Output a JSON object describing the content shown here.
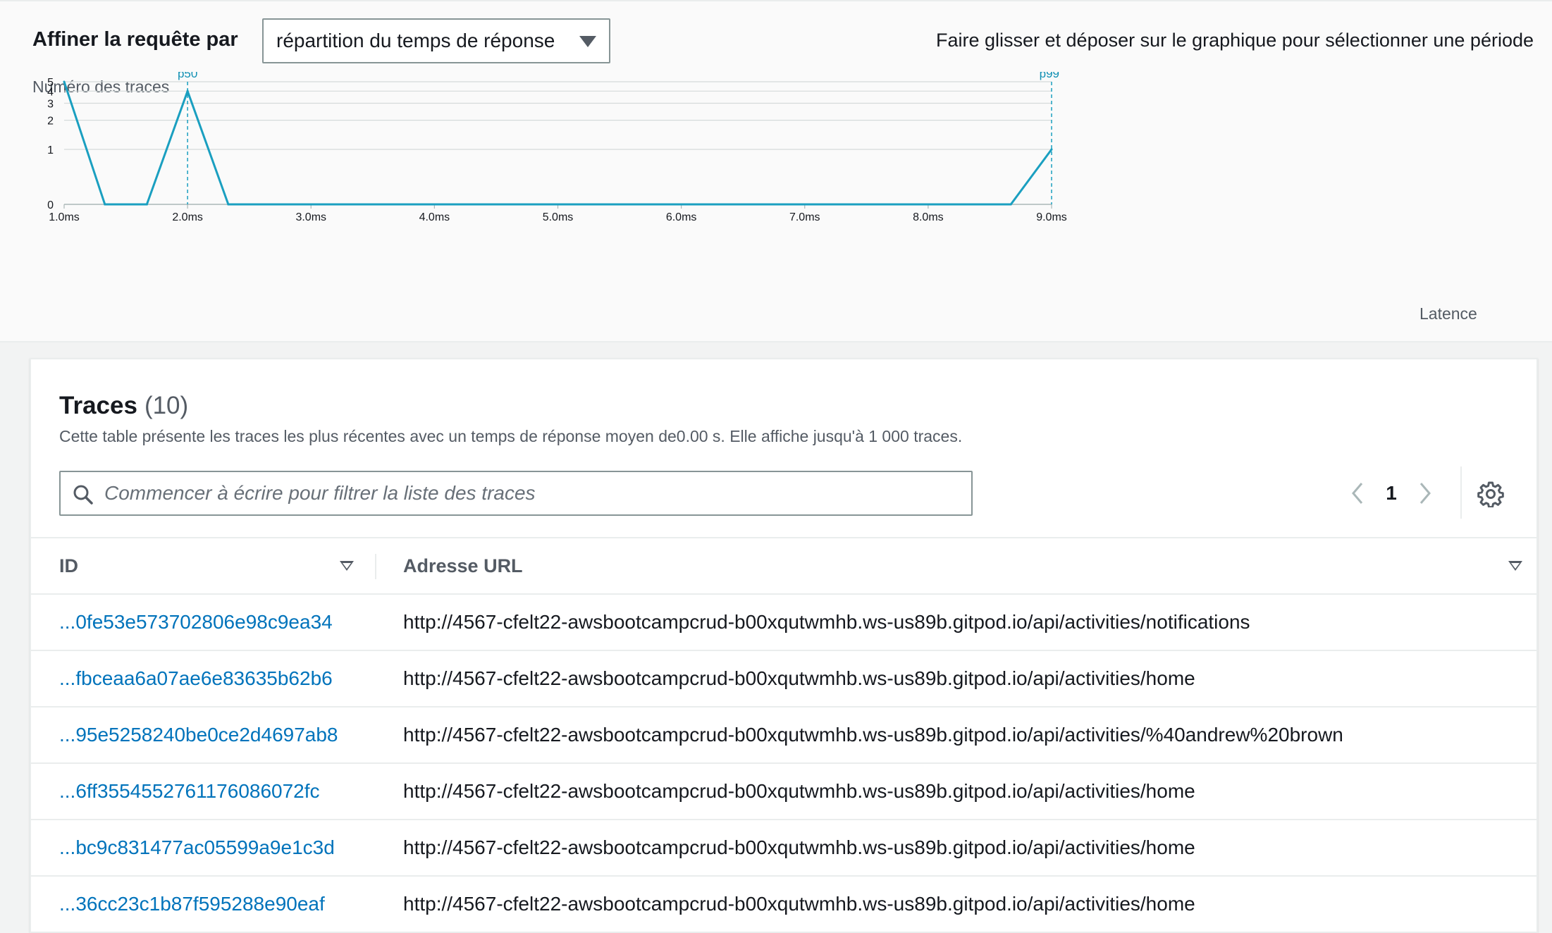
{
  "refine": {
    "label": "Affiner la requête par",
    "select_value": "répartition du temps de réponse",
    "drag_hint": "Faire glisser et déposer sur le graphique pour sélectionner une période"
  },
  "chart_data": {
    "type": "line",
    "ylabel": "Numéro des traces",
    "xlabel": "Latence",
    "x": [
      1.0,
      1.33,
      1.67,
      2.0,
      2.33,
      8.67,
      9.0
    ],
    "series": [
      {
        "values": [
          5,
          0,
          0,
          4,
          0,
          0,
          1
        ]
      }
    ],
    "xlim": [
      1.0,
      9.0
    ],
    "x_ticks": [
      "1.0ms",
      "2.0ms",
      "3.0ms",
      "4.0ms",
      "5.0ms",
      "6.0ms",
      "7.0ms",
      "8.0ms",
      "9.0ms"
    ],
    "y_ticks": [
      "0",
      "1",
      "2",
      "3",
      "4",
      "5"
    ],
    "y_scale": "log",
    "grid": true,
    "markers": [
      {
        "label": "p50",
        "x": 2.0
      },
      {
        "label": "p99",
        "x": 9.0
      }
    ],
    "color": "#1a9fc0"
  },
  "traces": {
    "title": "Traces",
    "count": "(10)",
    "description": "Cette table présente les traces les plus récentes avec un temps de réponse moyen de0.00 s. Elle affiche jusqu'à 1 000 traces.",
    "search_placeholder": "Commencer à écrire pour filtrer la liste des traces",
    "page": "1",
    "columns": {
      "id": "ID",
      "url": "Adresse URL"
    },
    "rows": [
      {
        "id": "...0fe53e573702806e98c9ea34",
        "url": "http://4567-cfelt22-awsbootcampcrud-b00xqutwmhb.ws-us89b.gitpod.io/api/activities/notifications"
      },
      {
        "id": "...fbceaa6a07ae6e83635b62b6",
        "url": "http://4567-cfelt22-awsbootcampcrud-b00xqutwmhb.ws-us89b.gitpod.io/api/activities/home"
      },
      {
        "id": "...95e5258240be0ce2d4697ab8",
        "url": "http://4567-cfelt22-awsbootcampcrud-b00xqutwmhb.ws-us89b.gitpod.io/api/activities/%40andrew%20brown"
      },
      {
        "id": "...6ff3554552761176086072fc",
        "url": "http://4567-cfelt22-awsbootcampcrud-b00xqutwmhb.ws-us89b.gitpod.io/api/activities/home"
      },
      {
        "id": "...bc9c831477ac05599a9e1c3d",
        "url": "http://4567-cfelt22-awsbootcampcrud-b00xqutwmhb.ws-us89b.gitpod.io/api/activities/home"
      },
      {
        "id": "...36cc23c1b87f595288e90eaf",
        "url": "http://4567-cfelt22-awsbootcampcrud-b00xqutwmhb.ws-us89b.gitpod.io/api/activities/home"
      }
    ]
  }
}
